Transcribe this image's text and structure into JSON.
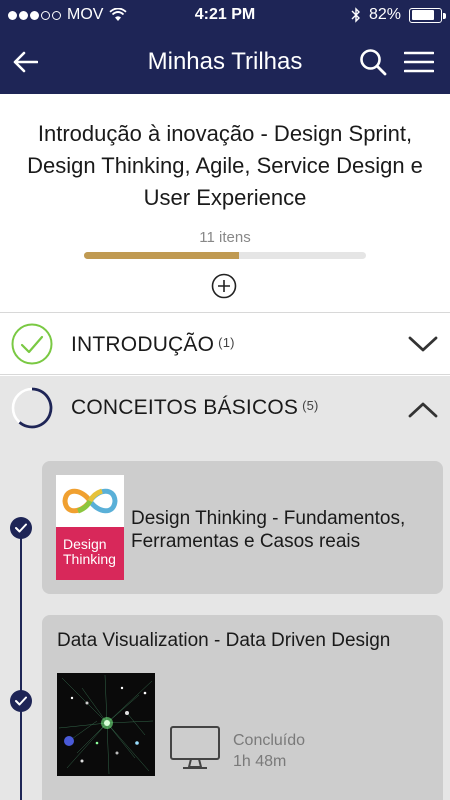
{
  "status_bar": {
    "carrier": "MOV",
    "time": "4:21 PM",
    "battery": "82%"
  },
  "app_bar": {
    "title": "Minhas Trilhas",
    "back_icon": "arrow-left-icon",
    "search_icon": "search-icon",
    "menu_icon": "hamburger-menu-icon"
  },
  "course": {
    "title": "Introdução à inovação - Design Sprint, Design Thinking, Agile, Service Design e User Experience",
    "items_count": "11 itens",
    "progress": 0.55,
    "progress_color": "#c09a52"
  },
  "sections": [
    {
      "label": "INTRODUÇÃO",
      "count": "(1)",
      "state": "completed",
      "expanded": false
    },
    {
      "label": "CONCEITOS BÁSICOS",
      "count": "(5)",
      "state": "in-progress",
      "expanded": true
    }
  ],
  "cards": [
    {
      "title": "Design Thinking - Fundamentos, Ferramentas e Casos reais",
      "thumbnail_text": "Design Thinking"
    },
    {
      "title": "Data Visualization - Data Driven Design",
      "status": "Concluído",
      "duration": "1h 48m"
    }
  ],
  "colors": {
    "primary": "#1e2556",
    "accent_green": "#7ac943",
    "progress": "#c09a52",
    "card_pink": "#d8285a"
  }
}
